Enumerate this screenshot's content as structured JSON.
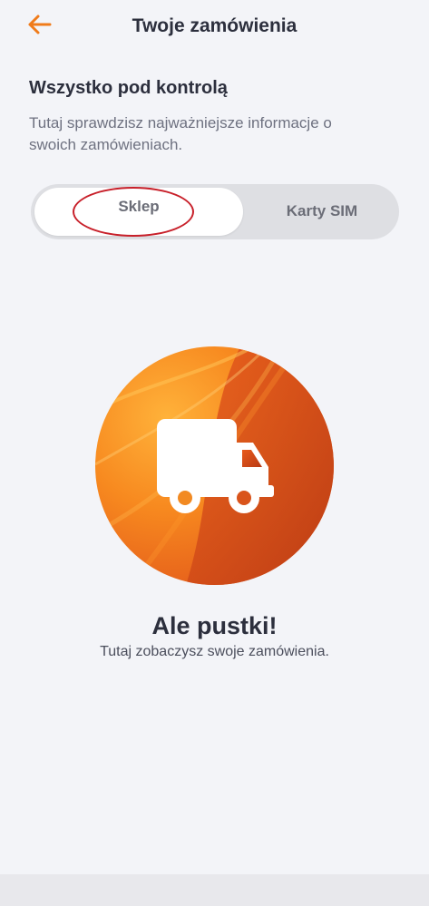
{
  "header": {
    "back_icon": "arrow-left-icon",
    "title": "Twoje zamówienia"
  },
  "intro": {
    "heading": "Wszystko pod kontrolą",
    "description": "Tutaj sprawdzisz najważniejsze informacje o swoich zamówieniach."
  },
  "tabs": [
    {
      "label": "Sklep",
      "selected": true
    },
    {
      "label": "Karty SIM",
      "selected": false
    }
  ],
  "empty_state": {
    "illustration_icon": "delivery-truck-icon",
    "title": "Ale pustki!",
    "subtitle": "Tutaj zobaczysz swoje zamówienia."
  },
  "colors": {
    "accent": "#f07b1a",
    "background": "#f3f4f8",
    "text_primary": "#2c2f3d",
    "annotation_circle": "#c8202a"
  }
}
